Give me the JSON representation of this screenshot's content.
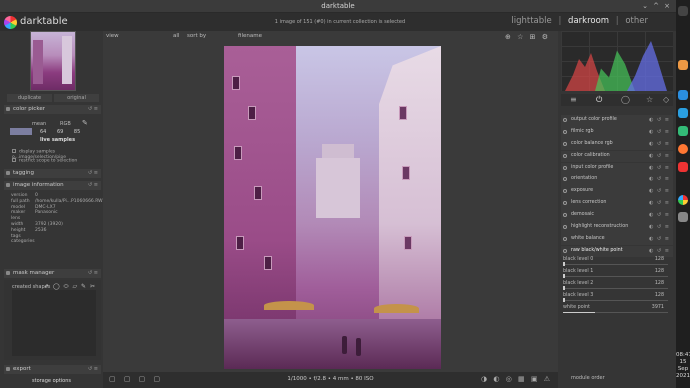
{
  "window": {
    "title": "darktable",
    "buttons": [
      "⌄",
      "^",
      "×"
    ]
  },
  "header": {
    "brand": "darktable",
    "status": "1 image of 151 (#0) in current collection is selected",
    "views": [
      "lighttable",
      "|",
      "darkroom",
      "|",
      "other"
    ],
    "active_view": "darkroom"
  },
  "left": {
    "tabs": [
      "duplicate",
      "original"
    ],
    "color_picker": {
      "title": "color picker",
      "mode": "mean",
      "space": "RGB",
      "values": "64 69 85",
      "live": "live samples",
      "opt1": "display samples o...image/selection/pipe",
      "opt2": "restrict scope to selection"
    },
    "tagging": "tagging",
    "image_information": {
      "title": "image information",
      "rows": [
        {
          "k": "version",
          "v": "0"
        },
        {
          "k": "full path",
          "v": "/home/kulla/Pi...P1060666.RW2"
        },
        {
          "k": "model",
          "v": "DMC-LX7"
        },
        {
          "k": "maker",
          "v": "Panasonic"
        },
        {
          "k": "lens",
          "v": ""
        },
        {
          "k": "width",
          "v": "3792 (3920)"
        },
        {
          "k": "height",
          "v": "2536"
        },
        {
          "k": "tags",
          "v": ""
        },
        {
          "k": "categories",
          "v": ""
        }
      ]
    },
    "mask_manager": {
      "title": "mask manager",
      "created": "created shapes",
      "tools": "↗ ◯ ⬭ ▱ ✎ ✂"
    },
    "export": "export",
    "storage": "storage options"
  },
  "center": {
    "filter_left": "view",
    "filter_all": "all",
    "sort_by": "sort by",
    "sort_value": "filename",
    "icons": "⊕ ☆ ⊞ ⚙",
    "bottom_info": "1/1000 • f/2.8 • 4 mm • 80 ISO",
    "bottom_left": "▢ ▢ ▢ ▢",
    "bottom_right": "◑ ◐ ◎ ▦ ▣ ⚠"
  },
  "right": {
    "groups": [
      "≡",
      "⏻",
      "◯",
      "☆",
      "◇"
    ],
    "modules": [
      "output color profile",
      "filmic rgb",
      "color balance rgb",
      "color calibration",
      "input color profile",
      "orientation",
      "exposure",
      "lens correction",
      "demosaic",
      "highlight reconstruction",
      "white balance",
      "raw black/white point"
    ],
    "sliders": [
      {
        "label": "black level 0",
        "value": "128"
      },
      {
        "label": "black level 1",
        "value": "128"
      },
      {
        "label": "black level 2",
        "value": "128"
      },
      {
        "label": "black level 3",
        "value": "128"
      },
      {
        "label": "white point",
        "value": "3971"
      }
    ],
    "module_order": "module order"
  },
  "taskbar": {
    "time": "08:47",
    "day": "15",
    "month": "Sep",
    "year": "2021"
  },
  "colors": {
    "accent": "#e8e8e8",
    "panel": "#353535"
  }
}
